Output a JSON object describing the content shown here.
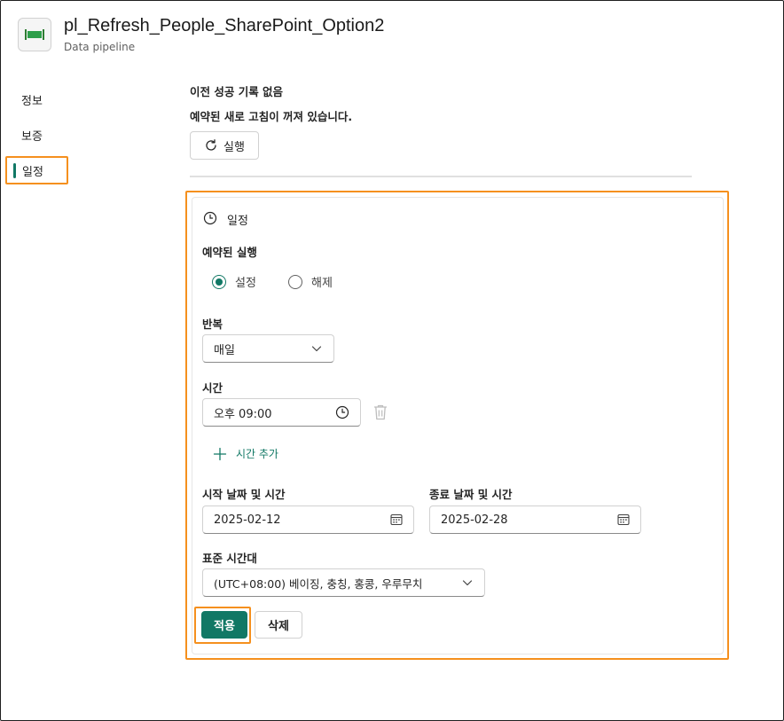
{
  "header": {
    "title": "pl_Refresh_People_SharePoint_Option2",
    "subtitle": "Data pipeline",
    "icon": "pipeline-icon"
  },
  "nav": {
    "items": [
      {
        "label": "정보"
      },
      {
        "label": "보증"
      },
      {
        "label": "일정",
        "active": true
      }
    ]
  },
  "status": {
    "last_success": "이전 성공 기록 없음",
    "schedule_state": "예약된 새로 고침이 꺼져 있습니다.",
    "run_label": "실행"
  },
  "schedule": {
    "title": "일정",
    "scheduled_run_label": "예약된 실행",
    "on_label": "설정",
    "off_label": "해제",
    "selected": "on",
    "repeat_label": "반복",
    "repeat_value": "매일",
    "time_label": "시간",
    "time_value": "오후 09:00",
    "add_time_label": "시간 추가",
    "start_label": "시작 날짜 및 시간",
    "start_value": "2025-02-12",
    "end_label": "종료 날짜 및 시간",
    "end_value": "2025-02-28",
    "timezone_label": "표준 시간대",
    "timezone_value": "(UTC+08:00) 베이징, 충칭, 홍콩, 우루무치",
    "apply_label": "적용",
    "delete_label": "삭제"
  },
  "colors": {
    "accent": "#117865",
    "highlight": "#f5901e"
  }
}
